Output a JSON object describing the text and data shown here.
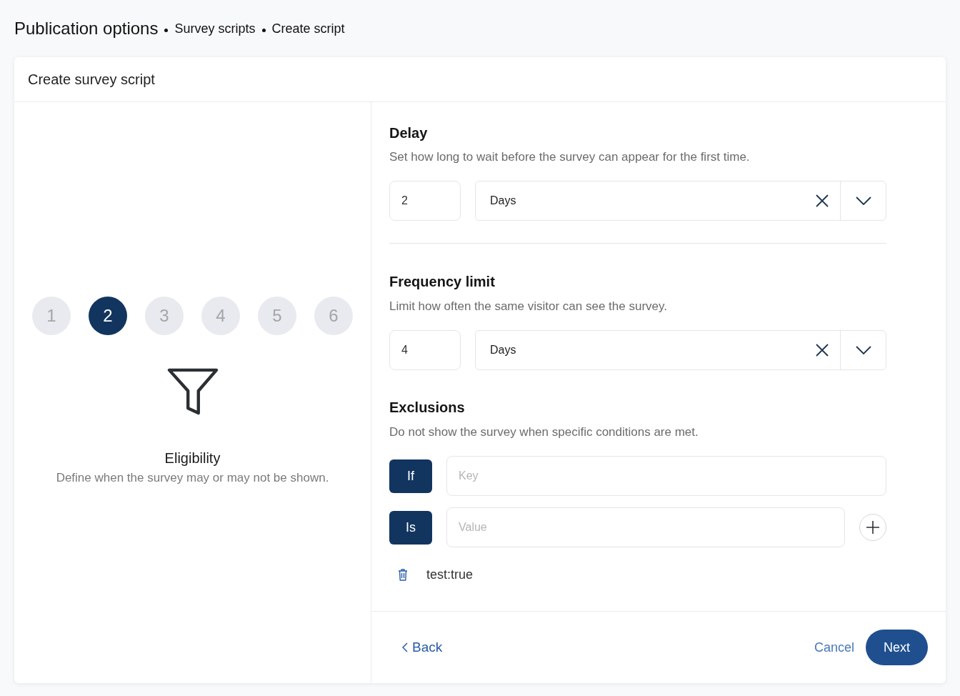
{
  "breadcrumb": [
    {
      "label": "Publication options",
      "kind": "title"
    },
    {
      "label": "Survey scripts",
      "kind": "link"
    },
    {
      "label": "Create script",
      "kind": "current"
    }
  ],
  "card": {
    "title": "Create survey script"
  },
  "steps": [
    {
      "label": "1",
      "selected": false
    },
    {
      "label": "2",
      "selected": true
    },
    {
      "label": "3",
      "selected": false
    },
    {
      "label": "4",
      "selected": false
    },
    {
      "label": "5",
      "selected": false
    },
    {
      "label": "6",
      "selected": false
    }
  ],
  "step_info": {
    "title": "Eligibility",
    "description": "Define when the survey may or may not be shown."
  },
  "sections": [
    {
      "kind": "amount",
      "title": "Delay",
      "description": "Set how long to wait before the survey can appear for the first time.",
      "amount": "2",
      "unit": "Days",
      "divider": true
    },
    {
      "kind": "amount",
      "title": "Frequency limit",
      "description": "Limit how often the same visitor can see the survey.",
      "amount": "4",
      "unit": "Days",
      "divider": false
    },
    {
      "kind": "conditions",
      "title": "Exclusions",
      "description": "Do not show the survey when specific conditions are met.",
      "divider": false,
      "conditions": [
        {
          "operator": "If",
          "placeholder": "Key",
          "add_button": false
        },
        {
          "operator": "Is",
          "placeholder": "Value",
          "add_button": true
        }
      ],
      "entries": [
        "test:true"
      ]
    }
  ],
  "footer": {
    "back": "Back",
    "cancel": "Cancel",
    "next": "Next"
  }
}
